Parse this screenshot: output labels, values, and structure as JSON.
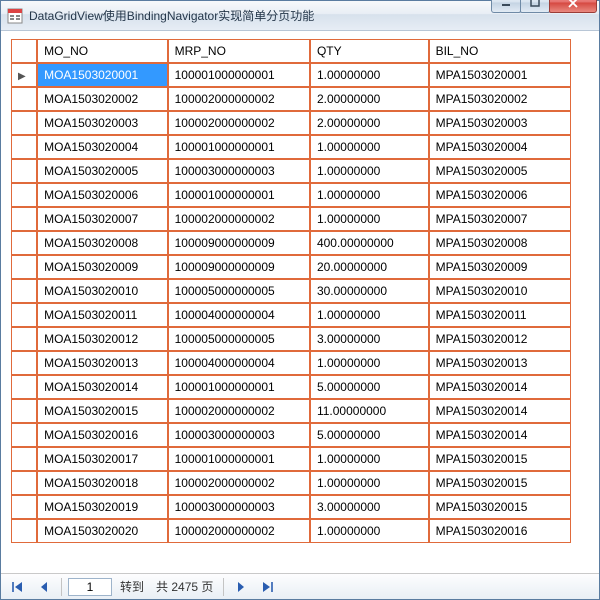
{
  "window": {
    "title": "DataGridView使用BindingNavigator实现简单分页功能"
  },
  "grid": {
    "columns": [
      "MO_NO",
      "MRP_NO",
      "QTY",
      "BIL_NO"
    ],
    "selected_row": 0,
    "rows": [
      [
        "MOA1503020001",
        "100001000000001",
        "1.00000000",
        "MPA1503020001"
      ],
      [
        "MOA1503020002",
        "100002000000002",
        "2.00000000",
        "MPA1503020002"
      ],
      [
        "MOA1503020003",
        "100002000000002",
        "2.00000000",
        "MPA1503020003"
      ],
      [
        "MOA1503020004",
        "100001000000001",
        "1.00000000",
        "MPA1503020004"
      ],
      [
        "MOA1503020005",
        "100003000000003",
        "1.00000000",
        "MPA1503020005"
      ],
      [
        "MOA1503020006",
        "100001000000001",
        "1.00000000",
        "MPA1503020006"
      ],
      [
        "MOA1503020007",
        "100002000000002",
        "1.00000000",
        "MPA1503020007"
      ],
      [
        "MOA1503020008",
        "100009000000009",
        "400.00000000",
        "MPA1503020008"
      ],
      [
        "MOA1503020009",
        "100009000000009",
        "20.00000000",
        "MPA1503020009"
      ],
      [
        "MOA1503020010",
        "100005000000005",
        "30.00000000",
        "MPA1503020010"
      ],
      [
        "MOA1503020011",
        "100004000000004",
        "1.00000000",
        "MPA1503020011"
      ],
      [
        "MOA1503020012",
        "100005000000005",
        "3.00000000",
        "MPA1503020012"
      ],
      [
        "MOA1503020013",
        "100004000000004",
        "1.00000000",
        "MPA1503020013"
      ],
      [
        "MOA1503020014",
        "100001000000001",
        "5.00000000",
        "MPA1503020014"
      ],
      [
        "MOA1503020015",
        "100002000000002",
        "11.00000000",
        "MPA1503020014"
      ],
      [
        "MOA1503020016",
        "100003000000003",
        "5.00000000",
        "MPA1503020014"
      ],
      [
        "MOA1503020017",
        "100001000000001",
        "1.00000000",
        "MPA1503020015"
      ],
      [
        "MOA1503020018",
        "100002000000002",
        "1.00000000",
        "MPA1503020015"
      ],
      [
        "MOA1503020019",
        "100003000000003",
        "3.00000000",
        "MPA1503020015"
      ],
      [
        "MOA1503020020",
        "100002000000002",
        "1.00000000",
        "MPA1503020016"
      ]
    ]
  },
  "navigator": {
    "current_page": "1",
    "goto_label": "转到",
    "total_label": "共 2475 页"
  }
}
